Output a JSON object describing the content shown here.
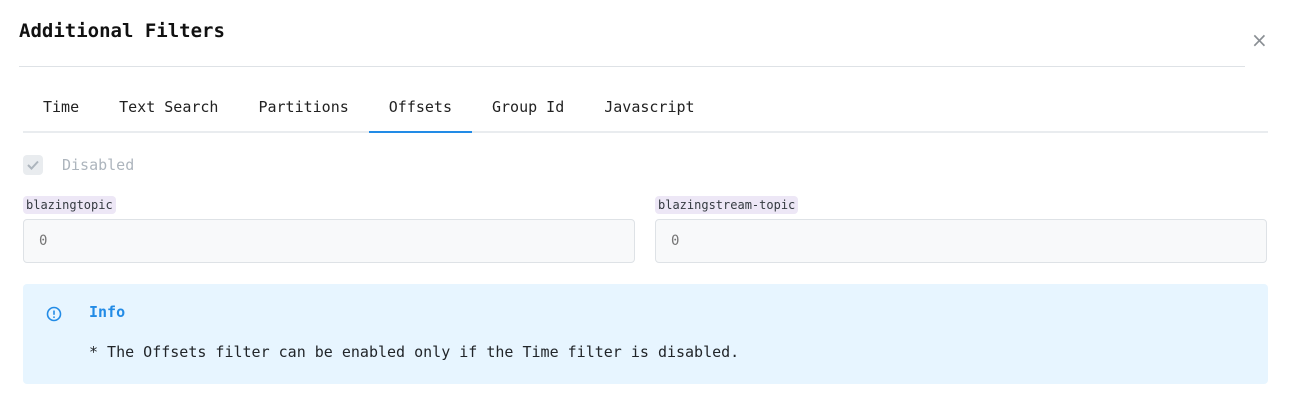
{
  "dialog": {
    "title": "Additional Filters",
    "close_label": "×"
  },
  "tabs": [
    {
      "label": "Time",
      "active": false
    },
    {
      "label": "Text Search",
      "active": false
    },
    {
      "label": "Partitions",
      "active": false
    },
    {
      "label": "Offsets",
      "active": true
    },
    {
      "label": "Group Id",
      "active": false
    },
    {
      "label": "Javascript",
      "active": false
    }
  ],
  "offsets": {
    "disabled_label": "Disabled",
    "disabled_checked": true,
    "topics": [
      {
        "name": "blazingtopic",
        "placeholder": "0"
      },
      {
        "name": "blazingstream-topic",
        "placeholder": "0"
      }
    ]
  },
  "info": {
    "title": "Info",
    "message": "* The Offsets filter can be enabled only if the Time filter is disabled."
  },
  "colors": {
    "accent": "#228be6",
    "info_bg": "#e7f5ff",
    "badge_bg": "#ede7f6"
  }
}
